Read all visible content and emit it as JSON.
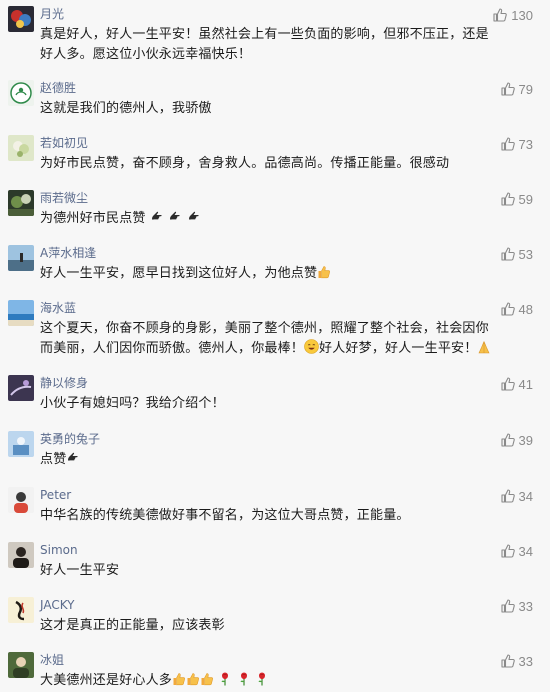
{
  "comments": [
    {
      "name": "月光",
      "text": "真是好人，好人一生平安！虽然社会上有一些负面的影响，但邪不压正，还是好人多。愿这位小伙永远幸福快乐！",
      "likes": "130"
    },
    {
      "name": "赵德胜",
      "text": "这就是我们的德州人，我骄傲",
      "likes": "79"
    },
    {
      "name": "若如初见",
      "text": "为好市民点赞，奋不顾身，舍身救人。品德高尚。传播正能量。很感动",
      "likes": "73"
    },
    {
      "name": "雨若微尘",
      "text": "为德州好市民点赞",
      "likes": "59"
    },
    {
      "name": "A萍水相逢",
      "text_a": "好人一生平安，愿早日找到这位好人，为他点赞",
      "likes": "53"
    },
    {
      "name": "海水蓝",
      "text_a": "这个夏天，你奋不顾身的身影，美丽了整个德州，照耀了整个社会，社会因你而美丽，人们因你而骄傲。德州人，你最棒！",
      "text_b": "好人好梦，好人一生平安！",
      "likes": "48"
    },
    {
      "name": "静以修身",
      "text": "小伙子有媳妇吗？我给介绍个！",
      "likes": "41"
    },
    {
      "name": "英勇的兔子",
      "text": "点赞",
      "likes": "39"
    },
    {
      "name": "Peter",
      "text": "中华名族的传统美德做好事不留名，为这位大哥点赞，正能量。",
      "likes": "34"
    },
    {
      "name": "Simon",
      "text": "好人一生平安",
      "likes": "34"
    },
    {
      "name": "JACKY",
      "text": "这才是真正的正能量，应该表彰",
      "likes": "33"
    },
    {
      "name": "冰姐",
      "text": "大美德州还是好心人多",
      "likes": "33"
    }
  ],
  "icons": {
    "like": "thumbs-up-outline-icon",
    "point": "pointing-hand-emoji-icon",
    "thumb": "thumbs-up-emoji-icon",
    "rose": "rose-emoji-icon",
    "pray": "praying-hands-emoji-icon",
    "smile": "smiley-emoji-icon"
  },
  "colors": {
    "name": "#5b6b8c",
    "text": "#1b1b1b",
    "likes": "#8a8a8a",
    "background": "#f7f7f7"
  }
}
